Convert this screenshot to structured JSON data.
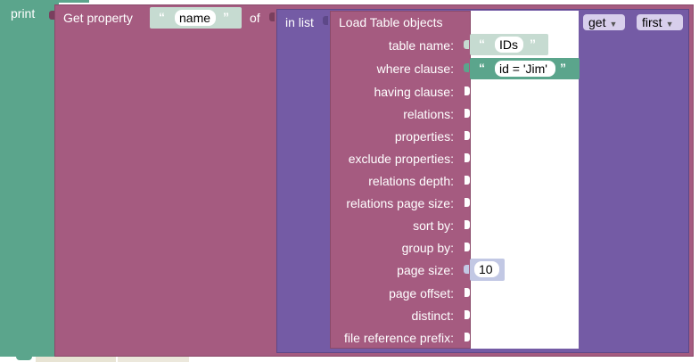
{
  "print": {
    "label": "print"
  },
  "get_property": {
    "label": "Get property",
    "property_name": "name",
    "of_label": "of"
  },
  "in_list": {
    "label": "in list",
    "mode_option": "get",
    "position_option": "first"
  },
  "load_table": {
    "label": "Load Table objects",
    "params": [
      {
        "label": "table name:"
      },
      {
        "label": "where clause:"
      },
      {
        "label": "having clause:"
      },
      {
        "label": "relations:"
      },
      {
        "label": "properties:"
      },
      {
        "label": "exclude properties:"
      },
      {
        "label": "relations depth:"
      },
      {
        "label": "relations page size:"
      },
      {
        "label": "sort by:"
      },
      {
        "label": "group by:"
      },
      {
        "label": "page size:"
      },
      {
        "label": "page offset:"
      },
      {
        "label": "distinct:"
      },
      {
        "label": "file reference prefix:"
      }
    ],
    "table_name_value": "IDs",
    "where_clause_value": "id = 'Jim'",
    "page_size_value": "10"
  },
  "quote_open": "“",
  "quote_close": "”",
  "colors": {
    "print_block": "#5ba58c",
    "get_property_block": "#a55b80",
    "in_list_block": "#745ba5",
    "text_block": "#c6dbd1",
    "number_block": "#c2c8e4"
  }
}
